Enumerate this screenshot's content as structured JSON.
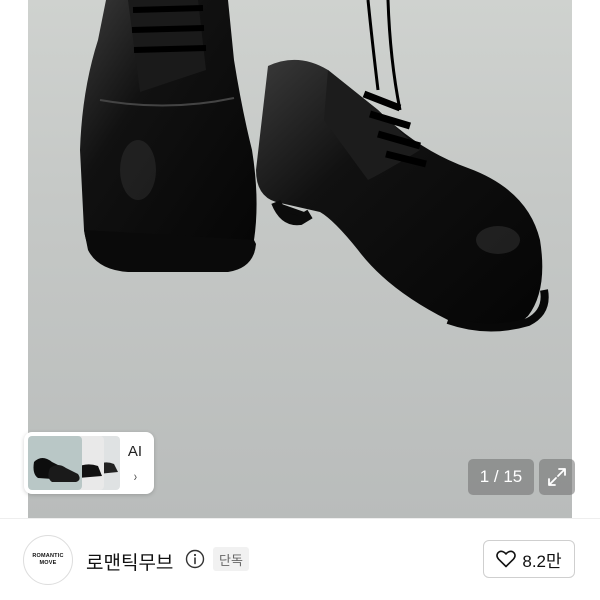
{
  "gallery": {
    "image_index": "1 / 15",
    "ai_label": "AI",
    "ai_chevron": "›"
  },
  "seller": {
    "avatar_text_line1": "ROMANTIC",
    "avatar_text_line2": "MOVE",
    "name": "로맨틱무브",
    "tag": "단독"
  },
  "like": {
    "count": "8.2만"
  },
  "icons": {
    "info": "info-icon",
    "expand": "expand-icon",
    "heart": "heart-outline-icon",
    "chevron": "chevron-right-icon"
  },
  "colors": {
    "hero_background": "#c5c8c6",
    "counter_background": "#6e6e6e",
    "tag_background": "#f1f1f1"
  }
}
